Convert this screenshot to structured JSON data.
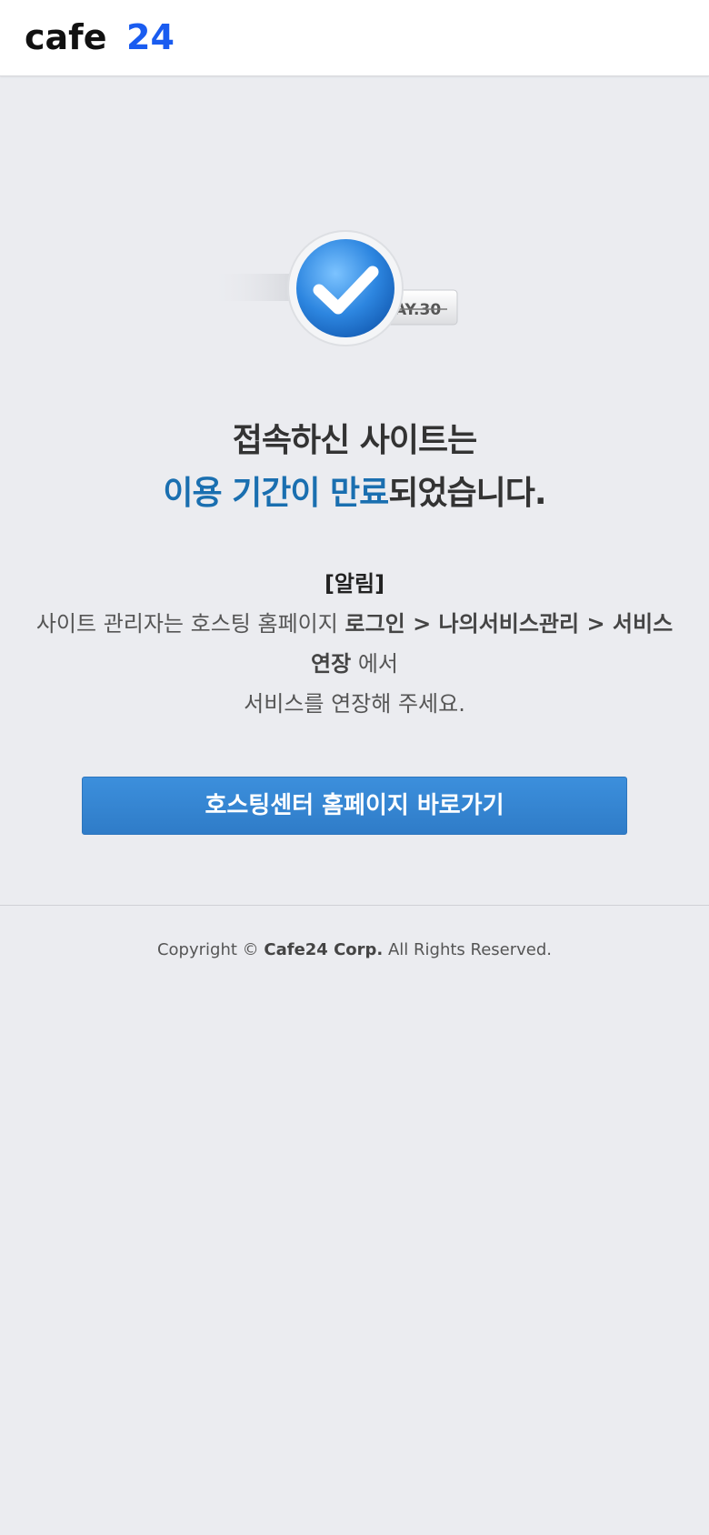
{
  "header": {
    "logo_text_dark": "cafe",
    "logo_text_accent": "24"
  },
  "hero": {
    "date_tag": "AY.30"
  },
  "headline": {
    "line1": "접속하신 사이트는",
    "line2_highlight": "이용 기간이 만료",
    "line2_rest": "되었습니다."
  },
  "notice": {
    "title": "[알림]",
    "text1": "사이트 관리자는 호스팅 홈페이지 ",
    "path1": "로그인 > 나의서비스관리 > 서비스",
    "path2": "연장",
    "text2": " 에서",
    "text3": "서비스를 연장해 주세요."
  },
  "button": {
    "label": "호스팅센터 홈페이지 바로가기"
  },
  "footer": {
    "prefix": "Copyright ",
    "symbol": "©",
    "company": "Cafe24 Corp.",
    "suffix": " All Rights Reserved."
  },
  "colors": {
    "background": "#ebecf0",
    "highlight": "#1a6fb0",
    "button": "#3487d3",
    "logo_accent": "#1a5cf0"
  }
}
